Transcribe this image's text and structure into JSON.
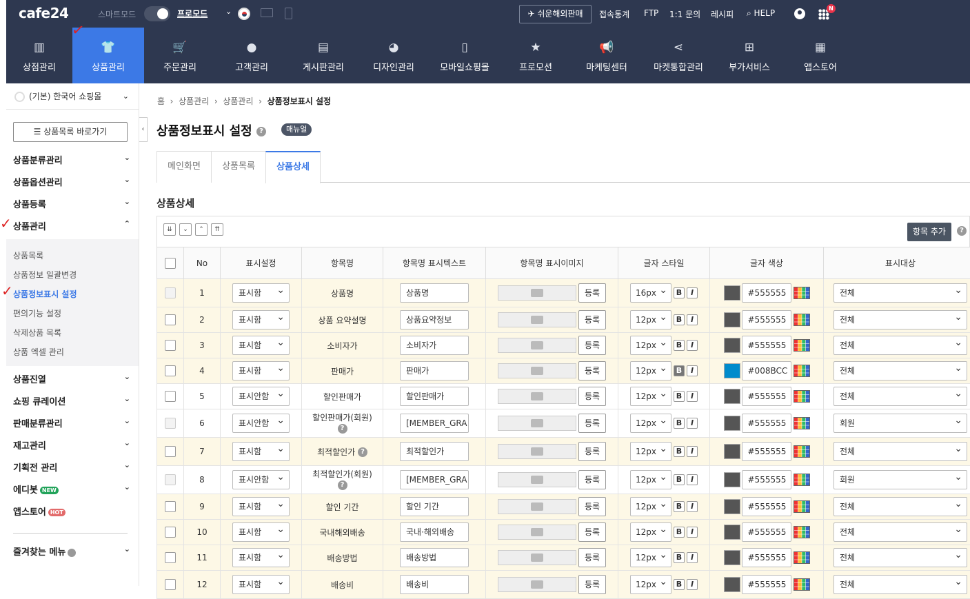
{
  "topbar": {
    "logo": "cafe24",
    "smart_mode": "스마트모드",
    "pro_mode": "프로모드",
    "easy_overseas": "쉬운해외판매",
    "links": [
      "접속통계",
      "FTP",
      "1:1 문의",
      "레시피",
      "HELP"
    ],
    "badge": "N"
  },
  "mainnav": [
    "상점관리",
    "상품관리",
    "주문관리",
    "고객관리",
    "게시판관리",
    "디자인관리",
    "모바일쇼핑몰",
    "프로모션",
    "마케팅센터",
    "마켓통합관리",
    "부가서비스",
    "앱스토어"
  ],
  "mainnav_active": "상품관리",
  "sidebar": {
    "shop": "(기본) 한국어 쇼핑몰",
    "goto_button": "상품목록 바로가기",
    "groups_top": [
      "상품분류관리",
      "상품옵션관리",
      "상품등록",
      "상품관리"
    ],
    "sub_items": [
      "상품목록",
      "상품정보 일괄변경",
      "상품정보표시 설정",
      "편의기능 설정",
      "삭제상품 목록",
      "상품 엑셀 관리"
    ],
    "sub_active": "상품정보표시 설정",
    "groups_bottom": [
      "상품진열",
      "쇼핑 큐레이션",
      "판매분류관리",
      "재고관리",
      "기획전 관리",
      "에디봇",
      "앱스토어"
    ],
    "new_badge": "NEW",
    "hot_badge": "HOT",
    "favorites": "즐겨찾는 메뉴"
  },
  "breadcrumb": [
    "홈",
    "상품관리",
    "상품관리",
    "상품정보표시 설정"
  ],
  "page_title": "상품정보표시 설정",
  "manual": "매뉴얼",
  "tabs": [
    "메인화면",
    "상품목록",
    "상품상세"
  ],
  "tab_active": "상품상세",
  "section_title": "상품상세",
  "add_item_button": "항목 추가",
  "table": {
    "headers": [
      "No",
      "표시설정",
      "항목명",
      "항목명 표시텍스트",
      "항목명 표시이미지",
      "글자 스타일",
      "글자 색상",
      "표시대상"
    ],
    "register_label": "등록",
    "rows": [
      {
        "no": "1",
        "display": "표시함",
        "name": "상품명",
        "text": "상품명",
        "size": "16px",
        "bold": false,
        "color": "#555555",
        "target": "전체",
        "hl": true,
        "disabled": true
      },
      {
        "no": "2",
        "display": "표시함",
        "name": "상품 요약설명",
        "text": "상품요약정보",
        "size": "12px",
        "bold": false,
        "color": "#555555",
        "target": "전체",
        "hl": true,
        "disabled": false
      },
      {
        "no": "3",
        "display": "표시함",
        "name": "소비자가",
        "text": "소비자가",
        "size": "12px",
        "bold": false,
        "color": "#555555",
        "target": "전체",
        "hl": true,
        "disabled": false
      },
      {
        "no": "4",
        "display": "표시함",
        "name": "판매가",
        "text": "판매가",
        "size": "12px",
        "bold": true,
        "color": "#008BCC",
        "target": "전체",
        "hl": true,
        "disabled": false
      },
      {
        "no": "5",
        "display": "표시안함",
        "name": "할인판매가",
        "text": "할인판매가",
        "size": "12px",
        "bold": false,
        "color": "#555555",
        "target": "전체",
        "hl": false,
        "disabled": false
      },
      {
        "no": "6",
        "display": "표시안함",
        "name": "할인판매가(회원)",
        "text": "[MEMBER_GRA",
        "size": "12px",
        "bold": false,
        "color": "#555555",
        "target": "회원",
        "hl": false,
        "disabled": true,
        "help": true
      },
      {
        "no": "7",
        "display": "표시함",
        "name": "최적할인가",
        "text": "최적할인가",
        "size": "12px",
        "bold": false,
        "color": "#555555",
        "target": "전체",
        "hl": true,
        "disabled": false,
        "help_inline": true
      },
      {
        "no": "8",
        "display": "표시안함",
        "name": "최적할인가(회원)",
        "text": "[MEMBER_GRA",
        "size": "12px",
        "bold": false,
        "color": "#555555",
        "target": "회원",
        "hl": false,
        "disabled": true,
        "help": true
      },
      {
        "no": "9",
        "display": "표시함",
        "name": "할인 기간",
        "text": "할인 기간",
        "size": "12px",
        "bold": false,
        "color": "#555555",
        "target": "전체",
        "hl": true,
        "disabled": false
      },
      {
        "no": "10",
        "display": "표시함",
        "name": "국내해외배송",
        "text": "국내·해외배송",
        "size": "12px",
        "bold": false,
        "color": "#555555",
        "target": "전체",
        "hl": true,
        "disabled": false
      },
      {
        "no": "11",
        "display": "표시함",
        "name": "배송방법",
        "text": "배송방법",
        "size": "12px",
        "bold": false,
        "color": "#555555",
        "target": "전체",
        "hl": true,
        "disabled": false
      },
      {
        "no": "12",
        "display": "표시함",
        "name": "배송비",
        "text": "배송비",
        "size": "12px",
        "bold": false,
        "color": "#555555",
        "target": "전체",
        "hl": true,
        "disabled": false
      }
    ]
  },
  "colors": {
    "nav_bg": "#2e3850",
    "accent": "#3c79e6",
    "row_highlight": "#fdf8e6"
  }
}
